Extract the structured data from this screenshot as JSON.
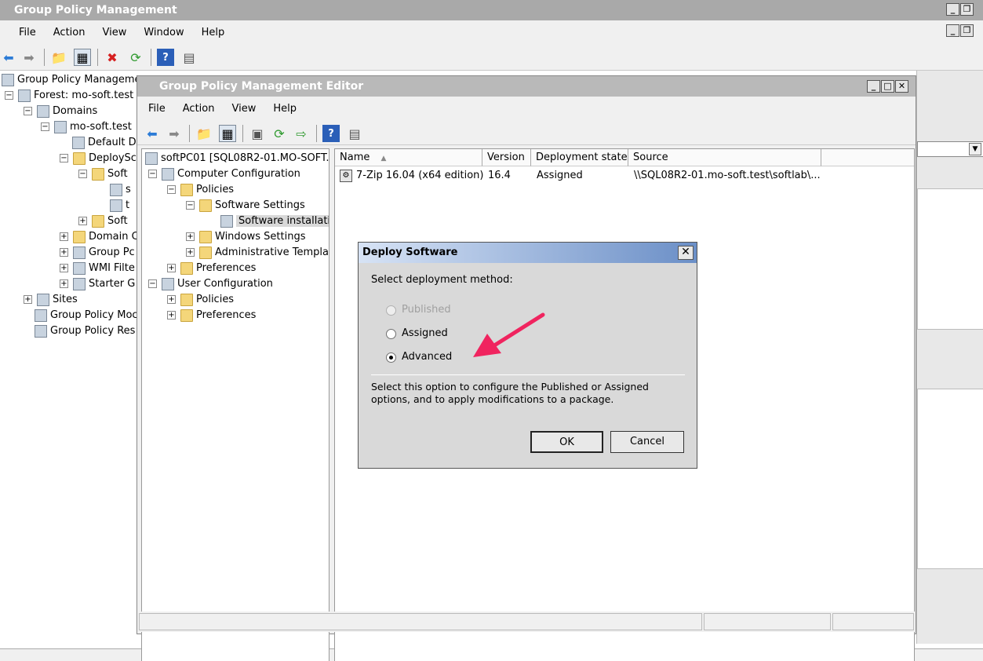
{
  "outer": {
    "title": "Group Policy Management",
    "menu": [
      "File",
      "Action",
      "View",
      "Window",
      "Help"
    ],
    "tree": [
      {
        "label": "Group Policy Managemer"
      },
      {
        "label": "Forest: mo-soft.test"
      },
      {
        "label": "Domains"
      },
      {
        "label": "mo-soft.test"
      },
      {
        "label": "Default D"
      },
      {
        "label": "DeploySc"
      },
      {
        "label": "Soft"
      },
      {
        "label": "s"
      },
      {
        "label": "t"
      },
      {
        "label": "Soft"
      },
      {
        "label": "Domain C"
      },
      {
        "label": "Group Pc"
      },
      {
        "label": "WMI Filte"
      },
      {
        "label": "Starter G"
      },
      {
        "label": "Sites"
      },
      {
        "label": "Group Policy Moc"
      },
      {
        "label": "Group Policy Res"
      }
    ]
  },
  "editor": {
    "title": "Group Policy Management Editor",
    "menu": [
      "File",
      "Action",
      "View",
      "Help"
    ],
    "tree": [
      {
        "label": "softPC01 [SQL08R2-01.MO-SOFT.T"
      },
      {
        "label": "Computer Configuration"
      },
      {
        "label": "Policies"
      },
      {
        "label": "Software Settings"
      },
      {
        "label": "Software installatio"
      },
      {
        "label": "Windows Settings"
      },
      {
        "label": "Administrative Templat"
      },
      {
        "label": "Preferences"
      },
      {
        "label": "User Configuration"
      },
      {
        "label": "Policies"
      },
      {
        "label": "Preferences"
      }
    ],
    "columns": [
      "Name",
      "Version",
      "Deployment state",
      "Source"
    ],
    "rows": [
      {
        "name": "7-Zip 16.04 (x64 edition)",
        "version": "16.4",
        "state": "Assigned",
        "source": "\\\\SQL08R2-01.mo-soft.test\\softlab\\..."
      }
    ]
  },
  "dialog": {
    "title": "Deploy Software",
    "prompt": "Select deployment method:",
    "options": [
      {
        "label": "Published",
        "enabled": false,
        "selected": false
      },
      {
        "label": "Assigned",
        "enabled": true,
        "selected": false
      },
      {
        "label": "Advanced",
        "enabled": true,
        "selected": true
      }
    ],
    "description": "Select this option to configure the Published or Assigned options, and to apply modifications to a package.",
    "ok_label": "OK",
    "cancel_label": "Cancel"
  },
  "colors": {
    "arrow": "#f0245f",
    "dialog_title_start": "#d7e3f5",
    "dialog_title_end": "#6b8fc7"
  }
}
